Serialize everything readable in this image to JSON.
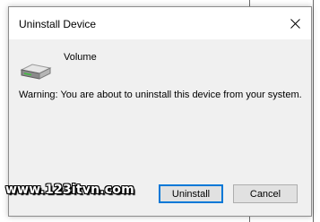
{
  "dialog": {
    "title": "Uninstall Device",
    "device_name": "Volume",
    "warning_text": "Warning: You are about to uninstall this device from your system.",
    "uninstall_label": "Uninstall",
    "cancel_label": "Cancel",
    "icons": {
      "close": "close-icon",
      "device": "drive-icon"
    },
    "colors": {
      "primary_button_border": "#0078d7",
      "dialog_background": "#f0f0f0"
    }
  },
  "watermark": {
    "text": "www.123itvn.com"
  }
}
